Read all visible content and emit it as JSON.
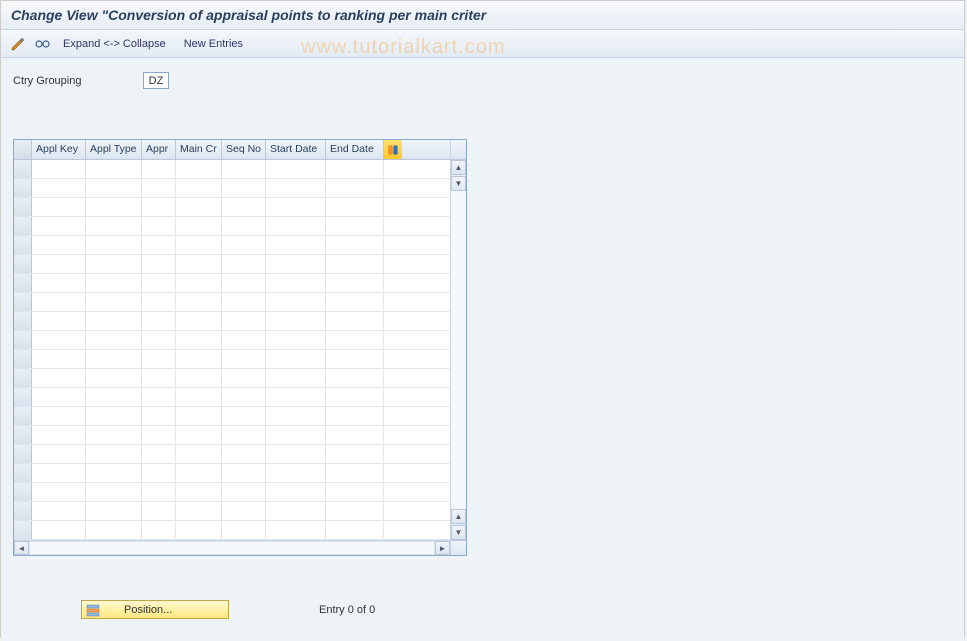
{
  "title": "Change View \"Conversion of appraisal points to ranking per main criter",
  "toolbar": {
    "expand_collapse": "Expand <-> Collapse",
    "new_entries": "New Entries"
  },
  "watermark": "www.tutorialkart.com",
  "fields": {
    "ctry_grouping_label": "Ctry Grouping",
    "ctry_grouping_value": "DZ"
  },
  "table": {
    "columns": {
      "appl_key": "Appl Key",
      "appl_type": "Appl Type",
      "appr": "Appr",
      "main_cr": "Main Cr",
      "seq_no": "Seq No",
      "start_date": "Start Date",
      "end_date": "End Date"
    },
    "rows": 20
  },
  "footer": {
    "position_label": "Position...",
    "entry_text": "Entry 0 of 0"
  }
}
